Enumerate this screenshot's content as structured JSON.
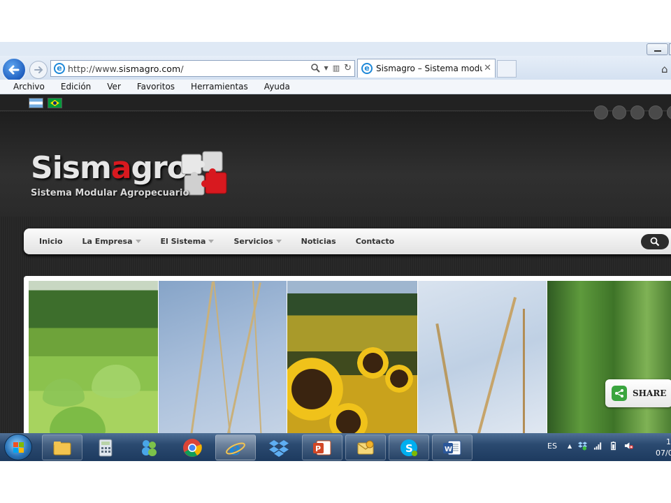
{
  "browser": {
    "url_prefix": "http://www.",
    "url_domain": "sismagro.com",
    "url_suffix": "/",
    "tab_title": "Sismagro – Sistema modul...",
    "menu": [
      "Archivo",
      "Edición",
      "Ver",
      "Favoritos",
      "Herramientas",
      "Ayuda"
    ]
  },
  "site": {
    "logo_part1": "Sism",
    "logo_red": "a",
    "logo_part2": "gro",
    "logo_subtitle": "Sistema Modular Agropecuario",
    "flags": [
      "argentina-flag",
      "brazil-flag"
    ],
    "nav": {
      "inicio": "Inicio",
      "empresa": "La Empresa",
      "sistema": "El Sistema",
      "servicios": "Servicios",
      "noticias": "Noticias",
      "contacto": "Contacto"
    },
    "share_label": "SHARE"
  },
  "taskbar": {
    "apps": [
      "file-explorer",
      "calculator",
      "windows-live-messenger",
      "chrome",
      "internet-explorer",
      "dropbox",
      "powerpoint",
      "outlook",
      "skype",
      "word"
    ],
    "active_app": "internet-explorer",
    "tray_language": "ES",
    "clock_time": "1",
    "clock_date": "07/0"
  },
  "colors": {
    "brand_red": "#d8191f",
    "share_green": "#3aa53f",
    "ie_blue": "#1f5fc0"
  }
}
